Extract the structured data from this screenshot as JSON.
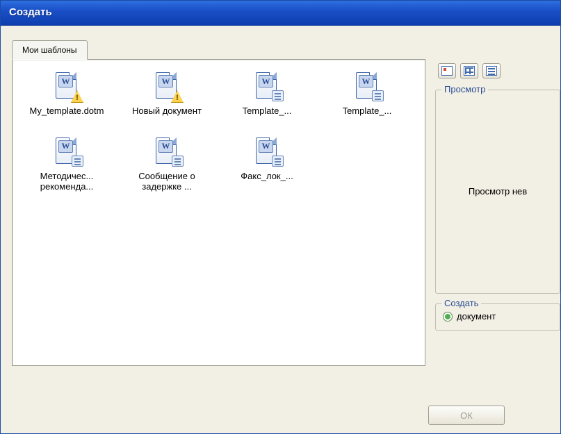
{
  "window": {
    "title": "Создать"
  },
  "tab": {
    "label": "Мои шаблоны"
  },
  "files": [
    {
      "label": "My_template.dotm",
      "overlay": "warn"
    },
    {
      "label": "Новый документ",
      "overlay": "warn"
    },
    {
      "label": "Template_...",
      "overlay": "lines"
    },
    {
      "label": "Template_...",
      "overlay": "lines"
    },
    {
      "label": "Методичес... рекоменда...",
      "overlay": "lines"
    },
    {
      "label": "Сообщение о задержке ...",
      "overlay": "lines"
    },
    {
      "label": "Факс_лок_...",
      "overlay": "lines"
    }
  ],
  "preview": {
    "group_label": "Просмотр",
    "message": "Просмотр нев"
  },
  "create_group": {
    "label": "Создать",
    "option_document": "документ"
  },
  "buttons": {
    "ok": "ОК"
  }
}
